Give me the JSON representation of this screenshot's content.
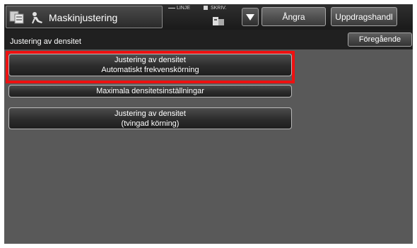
{
  "header": {
    "title": "Maskinjustering",
    "status_line_label": "LINJE",
    "status_print_label": "SKRIV.",
    "undo_label": "Ångra",
    "jobs_label": "Uppdragshandl",
    "icons": [
      "home-icon",
      "adjust-icon",
      "printer-status-icon",
      "dropdown-arrow-icon"
    ]
  },
  "subheader": {
    "title": "Justering av densitet",
    "back_label": "Föregående"
  },
  "options": [
    {
      "line1": "Justering av densitet",
      "line2": "Automatiskt frekvenskörning",
      "highlighted": true
    },
    {
      "line1": "Maximala densitetsinställningar",
      "line2": ""
    },
    {
      "line1": "Justering av densitet",
      "line2": "(tvingad körning)"
    }
  ],
  "colors": {
    "panel_background": "#595959",
    "highlight": "#ee1111"
  }
}
